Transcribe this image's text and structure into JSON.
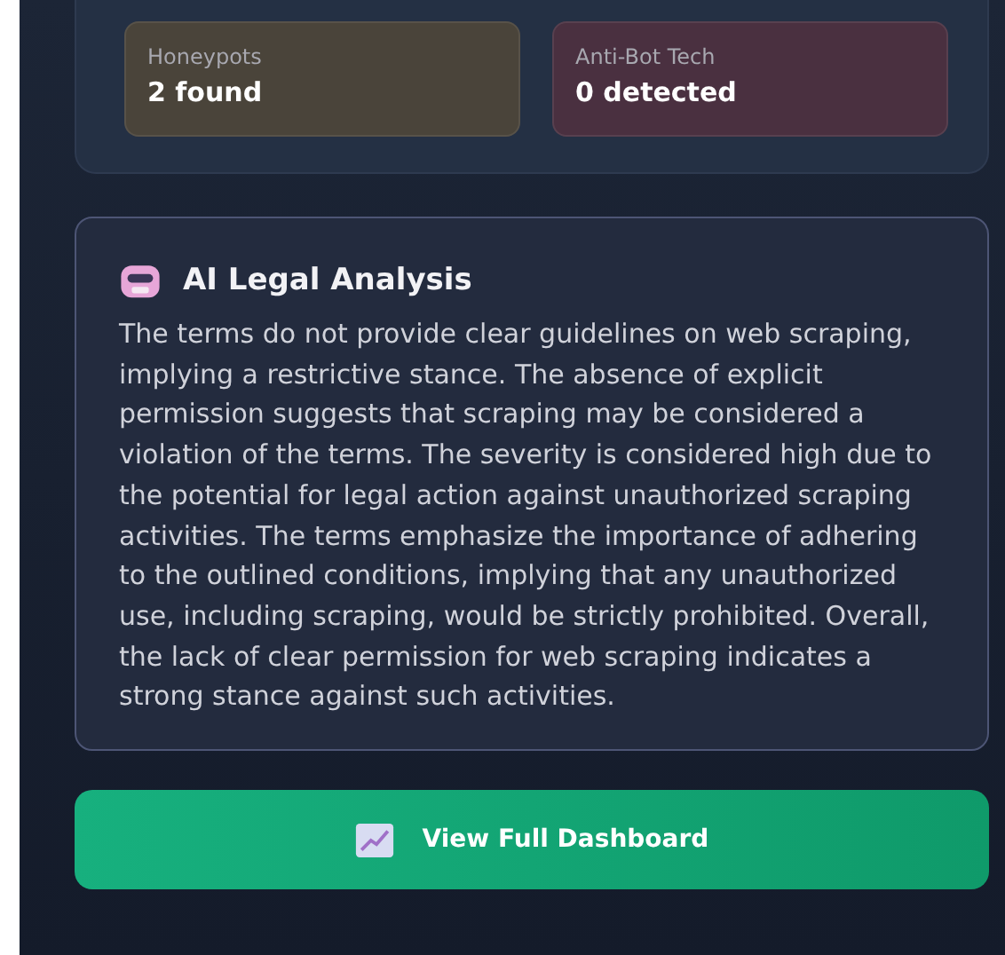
{
  "stats": [
    {
      "label": "Honeypots",
      "value": "2 found",
      "color": "#4a443a"
    },
    {
      "label": "Anti-Bot Tech",
      "value": "0 detected",
      "color": "#4a3040"
    }
  ],
  "analysis": {
    "title": "AI Legal Analysis",
    "text": "The terms do not provide clear guidelines on web scraping, implying a restrictive stance. The absence of explicit permission suggests that scraping may be considered a violation of the terms. The severity is considered high due to the potential for legal action against unauthorized scraping activities. The terms emphasize the importance of adhering to the outlined conditions, implying that any unauthorized use, including scraping, would be strictly prohibited. Overall, the lack of clear permission for web scraping indicates a strong stance against such activities."
  },
  "button": {
    "label": "View Full Dashboard"
  }
}
